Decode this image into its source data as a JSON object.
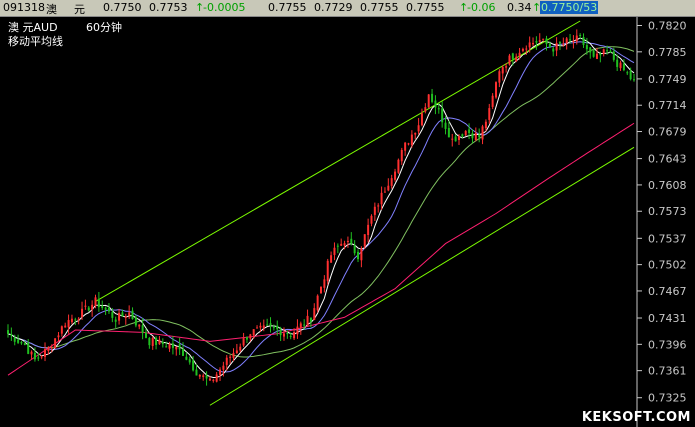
{
  "quote_bar": {
    "code": "091318",
    "name_1": "澳",
    "name_2": "元",
    "open": "0.7750",
    "high": "0.7753",
    "change_arrow": "↑",
    "change": "-0.0005",
    "last": "0.7755",
    "low": "0.7729",
    "bid": "0.7755",
    "ask": "0.7755",
    "pct_arrow": "↑",
    "pct": "-0.06",
    "volume": "0.34",
    "trade_arrow": "↑",
    "trade": "0.7750/53"
  },
  "chart_header": {
    "instrument": "澳    元AUD",
    "period": "60分钟",
    "indicator": "移动平均线"
  },
  "watermark": "KEKSOFT.COM",
  "chart_data": {
    "type": "line",
    "title": "",
    "y_ticks": [
      "0.7820",
      "0.7785",
      "0.7749",
      "0.7714",
      "0.7679",
      "0.7643",
      "0.7608",
      "0.7573",
      "0.7537",
      "0.7502",
      "0.7467",
      "0.7431",
      "0.7396",
      "0.7361",
      "0.7325"
    ],
    "ylim": [
      0.731,
      0.7826
    ],
    "grid": false,
    "colors": {
      "up_candle": "#ff3030",
      "down_candle": "#20c020",
      "ma_fast": "#ffffff",
      "ma_mid": "#8080ff",
      "ma_slow": "#80c060",
      "ma_long": "#ff2070",
      "channel": "#7cfc00",
      "axis": "#c8c8c8"
    },
    "price_path": [
      [
        0,
        0.741
      ],
      [
        5,
        0.7395
      ],
      [
        8,
        0.7375
      ],
      [
        12,
        0.739
      ],
      [
        17,
        0.7425
      ],
      [
        22,
        0.7438
      ],
      [
        26,
        0.7453
      ],
      [
        32,
        0.743
      ],
      [
        36,
        0.7438
      ],
      [
        42,
        0.74
      ],
      [
        48,
        0.7395
      ],
      [
        52,
        0.7385
      ],
      [
        56,
        0.736
      ],
      [
        60,
        0.7345
      ],
      [
        66,
        0.738
      ],
      [
        72,
        0.7412
      ],
      [
        78,
        0.7418
      ],
      [
        84,
        0.741
      ],
      [
        90,
        0.7432
      ],
      [
        96,
        0.7515
      ],
      [
        100,
        0.7535
      ],
      [
        104,
        0.7515
      ],
      [
        108,
        0.7565
      ],
      [
        114,
        0.7622
      ],
      [
        118,
        0.766
      ],
      [
        122,
        0.769
      ],
      [
        125,
        0.773
      ],
      [
        128,
        0.7705
      ],
      [
        132,
        0.7668
      ],
      [
        136,
        0.768
      ],
      [
        140,
        0.7672
      ],
      [
        143,
        0.7705
      ],
      [
        146,
        0.7762
      ],
      [
        150,
        0.778
      ],
      [
        154,
        0.7795
      ],
      [
        158,
        0.78
      ],
      [
        162,
        0.779
      ],
      [
        166,
        0.7798
      ],
      [
        170,
        0.7802
      ],
      [
        174,
        0.7775
      ],
      [
        178,
        0.7785
      ],
      [
        183,
        0.776
      ],
      [
        186,
        0.7745
      ]
    ],
    "channel_upper": [
      [
        26,
        0.7453
      ],
      [
        170,
        0.7826
      ]
    ],
    "channel_lower": [
      [
        60,
        0.7315
      ],
      [
        186,
        0.7658
      ]
    ],
    "ma_long_path": [
      [
        0,
        0.7355
      ],
      [
        20,
        0.7415
      ],
      [
        40,
        0.7412
      ],
      [
        60,
        0.74
      ],
      [
        80,
        0.741
      ],
      [
        100,
        0.7432
      ],
      [
        115,
        0.747
      ],
      [
        130,
        0.753
      ],
      [
        145,
        0.757
      ],
      [
        160,
        0.7615
      ],
      [
        172,
        0.765
      ],
      [
        186,
        0.769
      ]
    ]
  }
}
